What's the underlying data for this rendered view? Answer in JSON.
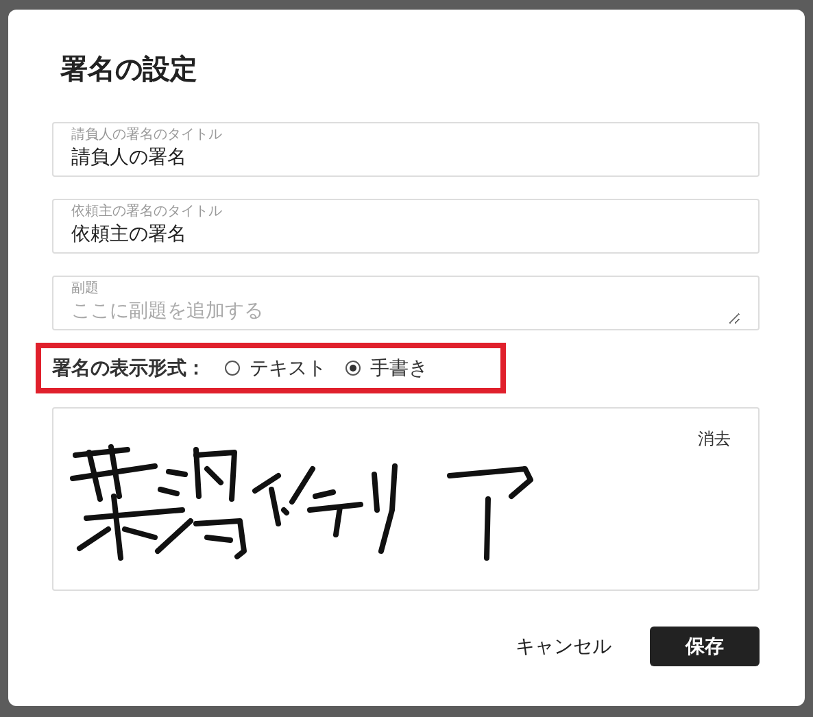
{
  "dialog": {
    "title": "署名の設定"
  },
  "fields": [
    {
      "label": "請負人の署名のタイトル",
      "value": "請負人の署名",
      "kind": "input"
    },
    {
      "label": "依頼主の署名のタイトル",
      "value": "依頼主の署名",
      "kind": "input"
    },
    {
      "label": "副題",
      "placeholder": "ここに副題を追加する",
      "kind": "textarea"
    }
  ],
  "display_format": {
    "label": "署名の表示形式：",
    "options": [
      {
        "label": "テキスト",
        "selected": false
      },
      {
        "label": "手書き",
        "selected": true
      }
    ]
  },
  "signature_pad": {
    "clear_label": "消去"
  },
  "buttons": [
    {
      "label": "キャンセル",
      "kind": "secondary"
    },
    {
      "label": "保存",
      "kind": "primary"
    }
  ]
}
